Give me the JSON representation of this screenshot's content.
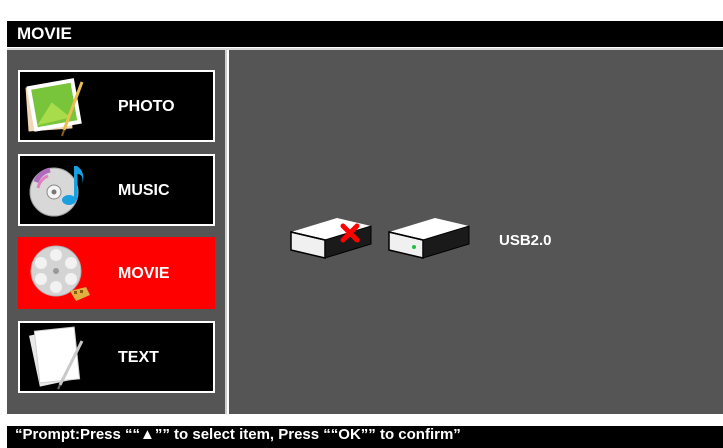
{
  "header": {
    "title": "MOVIE"
  },
  "menu": {
    "items": [
      {
        "label": "PHOTO",
        "icon": "photo-icon"
      },
      {
        "label": "MUSIC",
        "icon": "music-cd-icon"
      },
      {
        "label": "MOVIE",
        "icon": "film-reel-icon"
      },
      {
        "label": "TEXT",
        "icon": "text-document-icon"
      }
    ],
    "selected": "MOVIE"
  },
  "devices": {
    "usb_label": "USB2.0",
    "icons": [
      "drive-disconnected-icon",
      "usb-drive-icon"
    ]
  },
  "footer": {
    "prompt": "“Prompt:Press ““▲”” to select item, Press ““OK”” to confirm”"
  },
  "colors": {
    "background": "#555555",
    "title_bar": "#000000",
    "selected_item": "#ff0000",
    "text": "#ffffff"
  }
}
